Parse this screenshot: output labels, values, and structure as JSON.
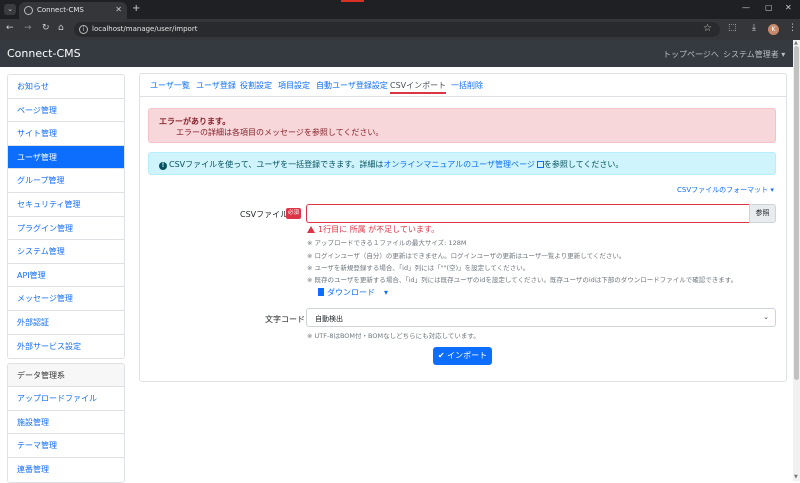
{
  "browser": {
    "tab_title": "Connect-CMS",
    "close": "✕",
    "new_tab": "+",
    "menu": "⌄",
    "url": "localhost/manage/user/import",
    "back": "←",
    "forward": "→",
    "reload": "↻",
    "home": "⌂",
    "star": "☆",
    "ext": "⬚",
    "download": "⤓",
    "kebab": "⋮",
    "profile_initial": "K",
    "min": "—",
    "max": "▢",
    "win_close": "✕"
  },
  "navbar": {
    "brand": "Connect-CMS",
    "top_page": "トップページへ",
    "admin": "システム管理者 ▾"
  },
  "sidebar": {
    "items": [
      {
        "label": "お知らせ"
      },
      {
        "label": "ページ管理"
      },
      {
        "label": "サイト管理"
      },
      {
        "label": "ユーザ管理"
      },
      {
        "label": "グループ管理"
      },
      {
        "label": "セキュリティ管理"
      },
      {
        "label": "プラグイン管理"
      },
      {
        "label": "システム管理"
      },
      {
        "label": "API管理"
      },
      {
        "label": "メッセージ管理"
      },
      {
        "label": "外部認証"
      },
      {
        "label": "外部サービス設定"
      }
    ],
    "data_header": "データ管理系",
    "data_items": [
      {
        "label": "アップロードファイル"
      },
      {
        "label": "施設管理"
      },
      {
        "label": "テーマ管理"
      },
      {
        "label": "連番管理"
      }
    ]
  },
  "tabs": [
    {
      "label": "ユーザ一覧"
    },
    {
      "label": "ユーザ登録"
    },
    {
      "label": "役割設定"
    },
    {
      "label": "項目設定"
    },
    {
      "label": "自動ユーザ登録設定"
    },
    {
      "label": "CSVインポート"
    },
    {
      "label": "一括削除"
    }
  ],
  "error_alert": {
    "heading": "エラーがあります。",
    "message": "エラーの詳細は各項目のメッセージを参照してください。"
  },
  "info_alert": {
    "icon": "!",
    "before": "CSVファイルを使って、ユーザを一括登録できます。詳細は",
    "link": "オンラインマニュアルのユーザ管理ページ",
    "after": "を参照してください。"
  },
  "csv_format_link": "CSVファイルのフォーマット ▾",
  "form": {
    "csv_label": "CSVファイル",
    "required_badge": "必須",
    "browse_button": "参照",
    "error_text": "1行目に 所属 が不足しています。",
    "notes": [
      "※ アップロードできる１ファイルの最大サイズ: 128M",
      "※ ログインユーザ（自分）の更新はできません。ログインユーザの更新はユーザ一覧より更新してください。",
      "※ ユーザを新規登録する場合、「id」列には「\"\"(空)」を設定してください。",
      "※ 既存のユーザを更新する場合、「id」列には既存ユーザのidを設定してください。既存ユーザのidは下部のダウンロードファイルで確認できます。"
    ],
    "download_button": "ダウンロード",
    "download_caret": "▾",
    "encoding_label": "文字コード",
    "encoding_value": "自動検出",
    "encoding_chevron": "⌄",
    "encoding_note": "※ UTF-8はBOM付・BOMなしどちらにも対応しています。",
    "import_button": "✔ インポート"
  }
}
